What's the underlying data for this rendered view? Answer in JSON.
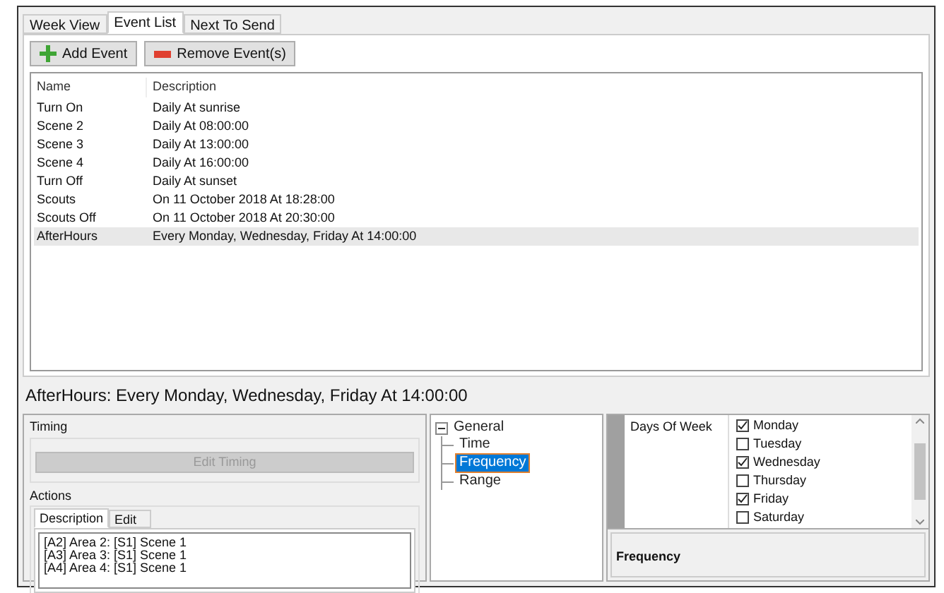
{
  "tabs": [
    {
      "label": "Week View",
      "selected": false
    },
    {
      "label": "Event List",
      "selected": true
    },
    {
      "label": "Next To Send",
      "selected": false
    }
  ],
  "toolbar": [
    {
      "kind": "add",
      "label": "Add Event"
    },
    {
      "kind": "remove",
      "label": "Remove Event(s)"
    }
  ],
  "table": {
    "columns": [
      "Name",
      "Description"
    ],
    "rows": [
      {
        "name": "Turn On",
        "description": "Daily At sunrise",
        "selected": false
      },
      {
        "name": "Scene 2",
        "description": "Daily At 08:00:00",
        "selected": false
      },
      {
        "name": "Scene 3",
        "description": "Daily At 13:00:00",
        "selected": false
      },
      {
        "name": "Scene 4",
        "description": "Daily At 16:00:00",
        "selected": false
      },
      {
        "name": "Turn Off",
        "description": "Daily At sunset",
        "selected": false
      },
      {
        "name": "Scouts",
        "description": "On 11 October 2018 At 18:28:00",
        "selected": false
      },
      {
        "name": "Scouts Off",
        "description": "On 11 October 2018 At 20:30:00",
        "selected": false
      },
      {
        "name": "AfterHours",
        "description": "Every Monday, Wednesday, Friday At 14:00:00",
        "selected": true
      }
    ]
  },
  "summary": "AfterHours: Every Monday, Wednesday, Friday At 14:00:00",
  "timing": {
    "title": "Timing",
    "button": "Edit Timing",
    "disabled": true
  },
  "actions": {
    "title": "Actions",
    "tabs": [
      {
        "label": "Description",
        "selected": true
      },
      {
        "label": "Edit",
        "selected": false
      }
    ],
    "lines": [
      "[A2] Area 2: [S1] Scene 1",
      "[A3] Area 3: [S1] Scene 1",
      "[A4] Area 4: [S1] Scene 1"
    ]
  },
  "tree": [
    {
      "label": "General",
      "expanded": true,
      "selected": false,
      "children": [
        {
          "label": "Time",
          "selected": false
        },
        {
          "label": "Frequency",
          "selected": true
        },
        {
          "label": "Range",
          "selected": false
        }
      ]
    }
  ],
  "property": {
    "label": "Days Of Week",
    "days": [
      {
        "label": "Monday",
        "checked": true
      },
      {
        "label": "Tuesday",
        "checked": false
      },
      {
        "label": "Wednesday",
        "checked": true
      },
      {
        "label": "Thursday",
        "checked": false
      },
      {
        "label": "Friday",
        "checked": true
      },
      {
        "label": "Saturday",
        "checked": false
      }
    ]
  },
  "help_title": "Frequency"
}
